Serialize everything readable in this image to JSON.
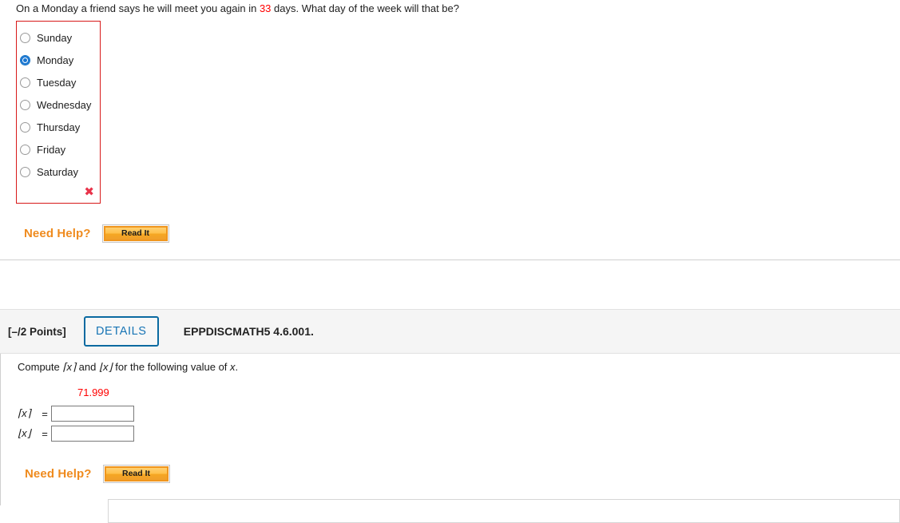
{
  "question1": {
    "stem_prefix": "On a Monday a friend says he will meet you again in ",
    "stem_value": "33",
    "stem_suffix": " days. What day of the week will that be?",
    "choices": [
      {
        "label": "Sunday",
        "selected": false
      },
      {
        "label": "Monday",
        "selected": true
      },
      {
        "label": "Tuesday",
        "selected": false
      },
      {
        "label": "Wednesday",
        "selected": false
      },
      {
        "label": "Thursday",
        "selected": false
      },
      {
        "label": "Friday",
        "selected": false
      },
      {
        "label": "Saturday",
        "selected": false
      }
    ],
    "wrong_mark": "✖",
    "help_label": "Need Help?",
    "read_it_label": "Read It"
  },
  "question2": {
    "points": "[–/2 Points]",
    "details_label": "DETAILS",
    "question_code": "EPPDISCMATH5 4.6.001.",
    "stem_prefix": "Compute ",
    "stem_ceil": "⌈x⌉",
    "stem_mid": " and ",
    "stem_floor": "⌊x⌋",
    "stem_suffix": " for the following value of ",
    "stem_var": "x",
    "stem_end": ".",
    "value": "71.999",
    "answers": [
      {
        "label": "⌈x⌉",
        "equals": "=",
        "value": "",
        "placeholder": ""
      },
      {
        "label": "⌊x⌋",
        "equals": "=",
        "value": "",
        "placeholder": ""
      }
    ],
    "help_label": "Need Help?",
    "read_it_label": "Read It"
  },
  "colors": {
    "red_value": "#ff0000",
    "incorrect_border": "#d81919",
    "wrong_mark": "#e8334a",
    "help_orange": "#ef8b1e",
    "details_blue": "#0a6aa1",
    "button_gold": "#f5a623"
  }
}
